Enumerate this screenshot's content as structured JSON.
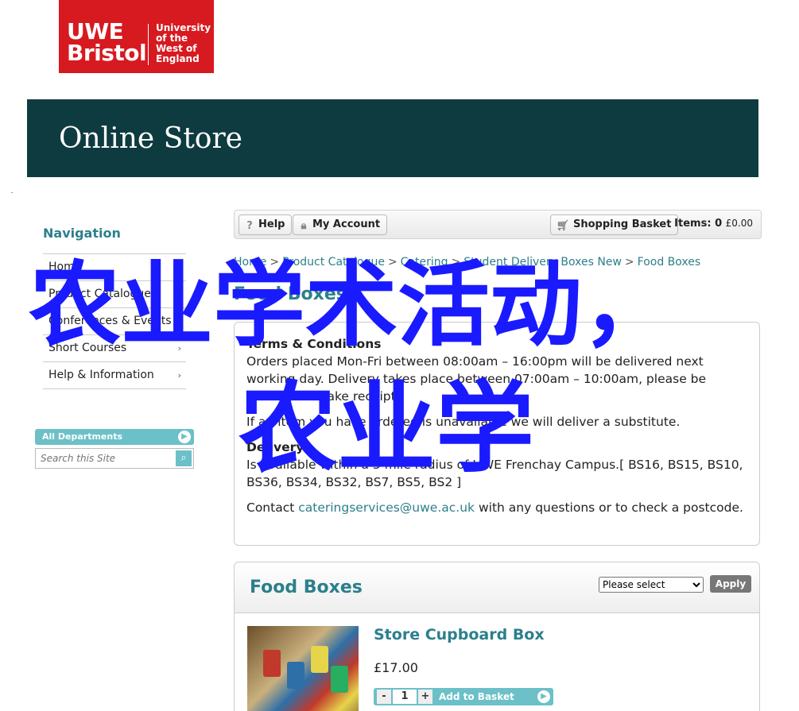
{
  "logo": {
    "line1": "UWE",
    "line2": "Bristol",
    "uni1": "University",
    "uni2": "of the",
    "uni3": "West of",
    "uni4": "England"
  },
  "banner": {
    "title": "Online Store"
  },
  "navigation": {
    "title": "Navigation",
    "items": [
      {
        "label": "Home"
      },
      {
        "label": "Product Catalogue",
        "arrow": "›"
      },
      {
        "label": "Conferences & Events",
        "arrow": "›"
      },
      {
        "label": "Short Courses",
        "arrow": "›"
      },
      {
        "label": "Help & Information",
        "arrow": "›"
      }
    ]
  },
  "search": {
    "header": "All Departments",
    "placeholder": "Search this Site"
  },
  "toolbar": {
    "help": "Help",
    "account": "My Account",
    "basket": "Shopping Basket",
    "items_label": "Items:",
    "items_count": "0",
    "items_total": "£0.00"
  },
  "breadcrumb": {
    "links": [
      "Home",
      "Product Catalogue",
      "Catering",
      "Student Delivery Boxes New",
      "Food Boxes"
    ],
    "separator": ">"
  },
  "page_title": "Food Boxes",
  "terms": {
    "heading": "Terms & Conditions",
    "para1": "Orders placed Mon-Fri between 08:00am – 16:00pm will be delivered next working day. Delivery takes place between 07:00am – 10:00am, please be available to take receipt.",
    "para2": "If an item you have ordered is unavailable we will deliver a substitute.",
    "delivery_heading": "Delivery",
    "delivery_text": "Is available within a 5 mile radius of UWE Frenchay Campus.[ BS16, BS15, BS10, BS36, BS34, BS32, BS7, BS5, BS2 ]",
    "contact_prefix": "Contact ",
    "contact_email": "cateringservices@uwe.ac.uk",
    "contact_suffix": " with any questions or to check a postcode."
  },
  "product_panel": {
    "title": "Food Boxes",
    "sort_selected": "Please select",
    "apply": "Apply",
    "products": [
      {
        "name": "Store Cupboard Box",
        "price": "£17.00",
        "quantity": "1",
        "add_label": "Add to Basket"
      }
    ]
  },
  "overlay": {
    "line1": "农业学术活动，",
    "line2": "农业学"
  },
  "colors": {
    "brand_red": "#d71920",
    "banner_teal": "#0e3b3f",
    "accent_teal": "#2c7f8c",
    "overlay_blue": "#1a1aff"
  }
}
